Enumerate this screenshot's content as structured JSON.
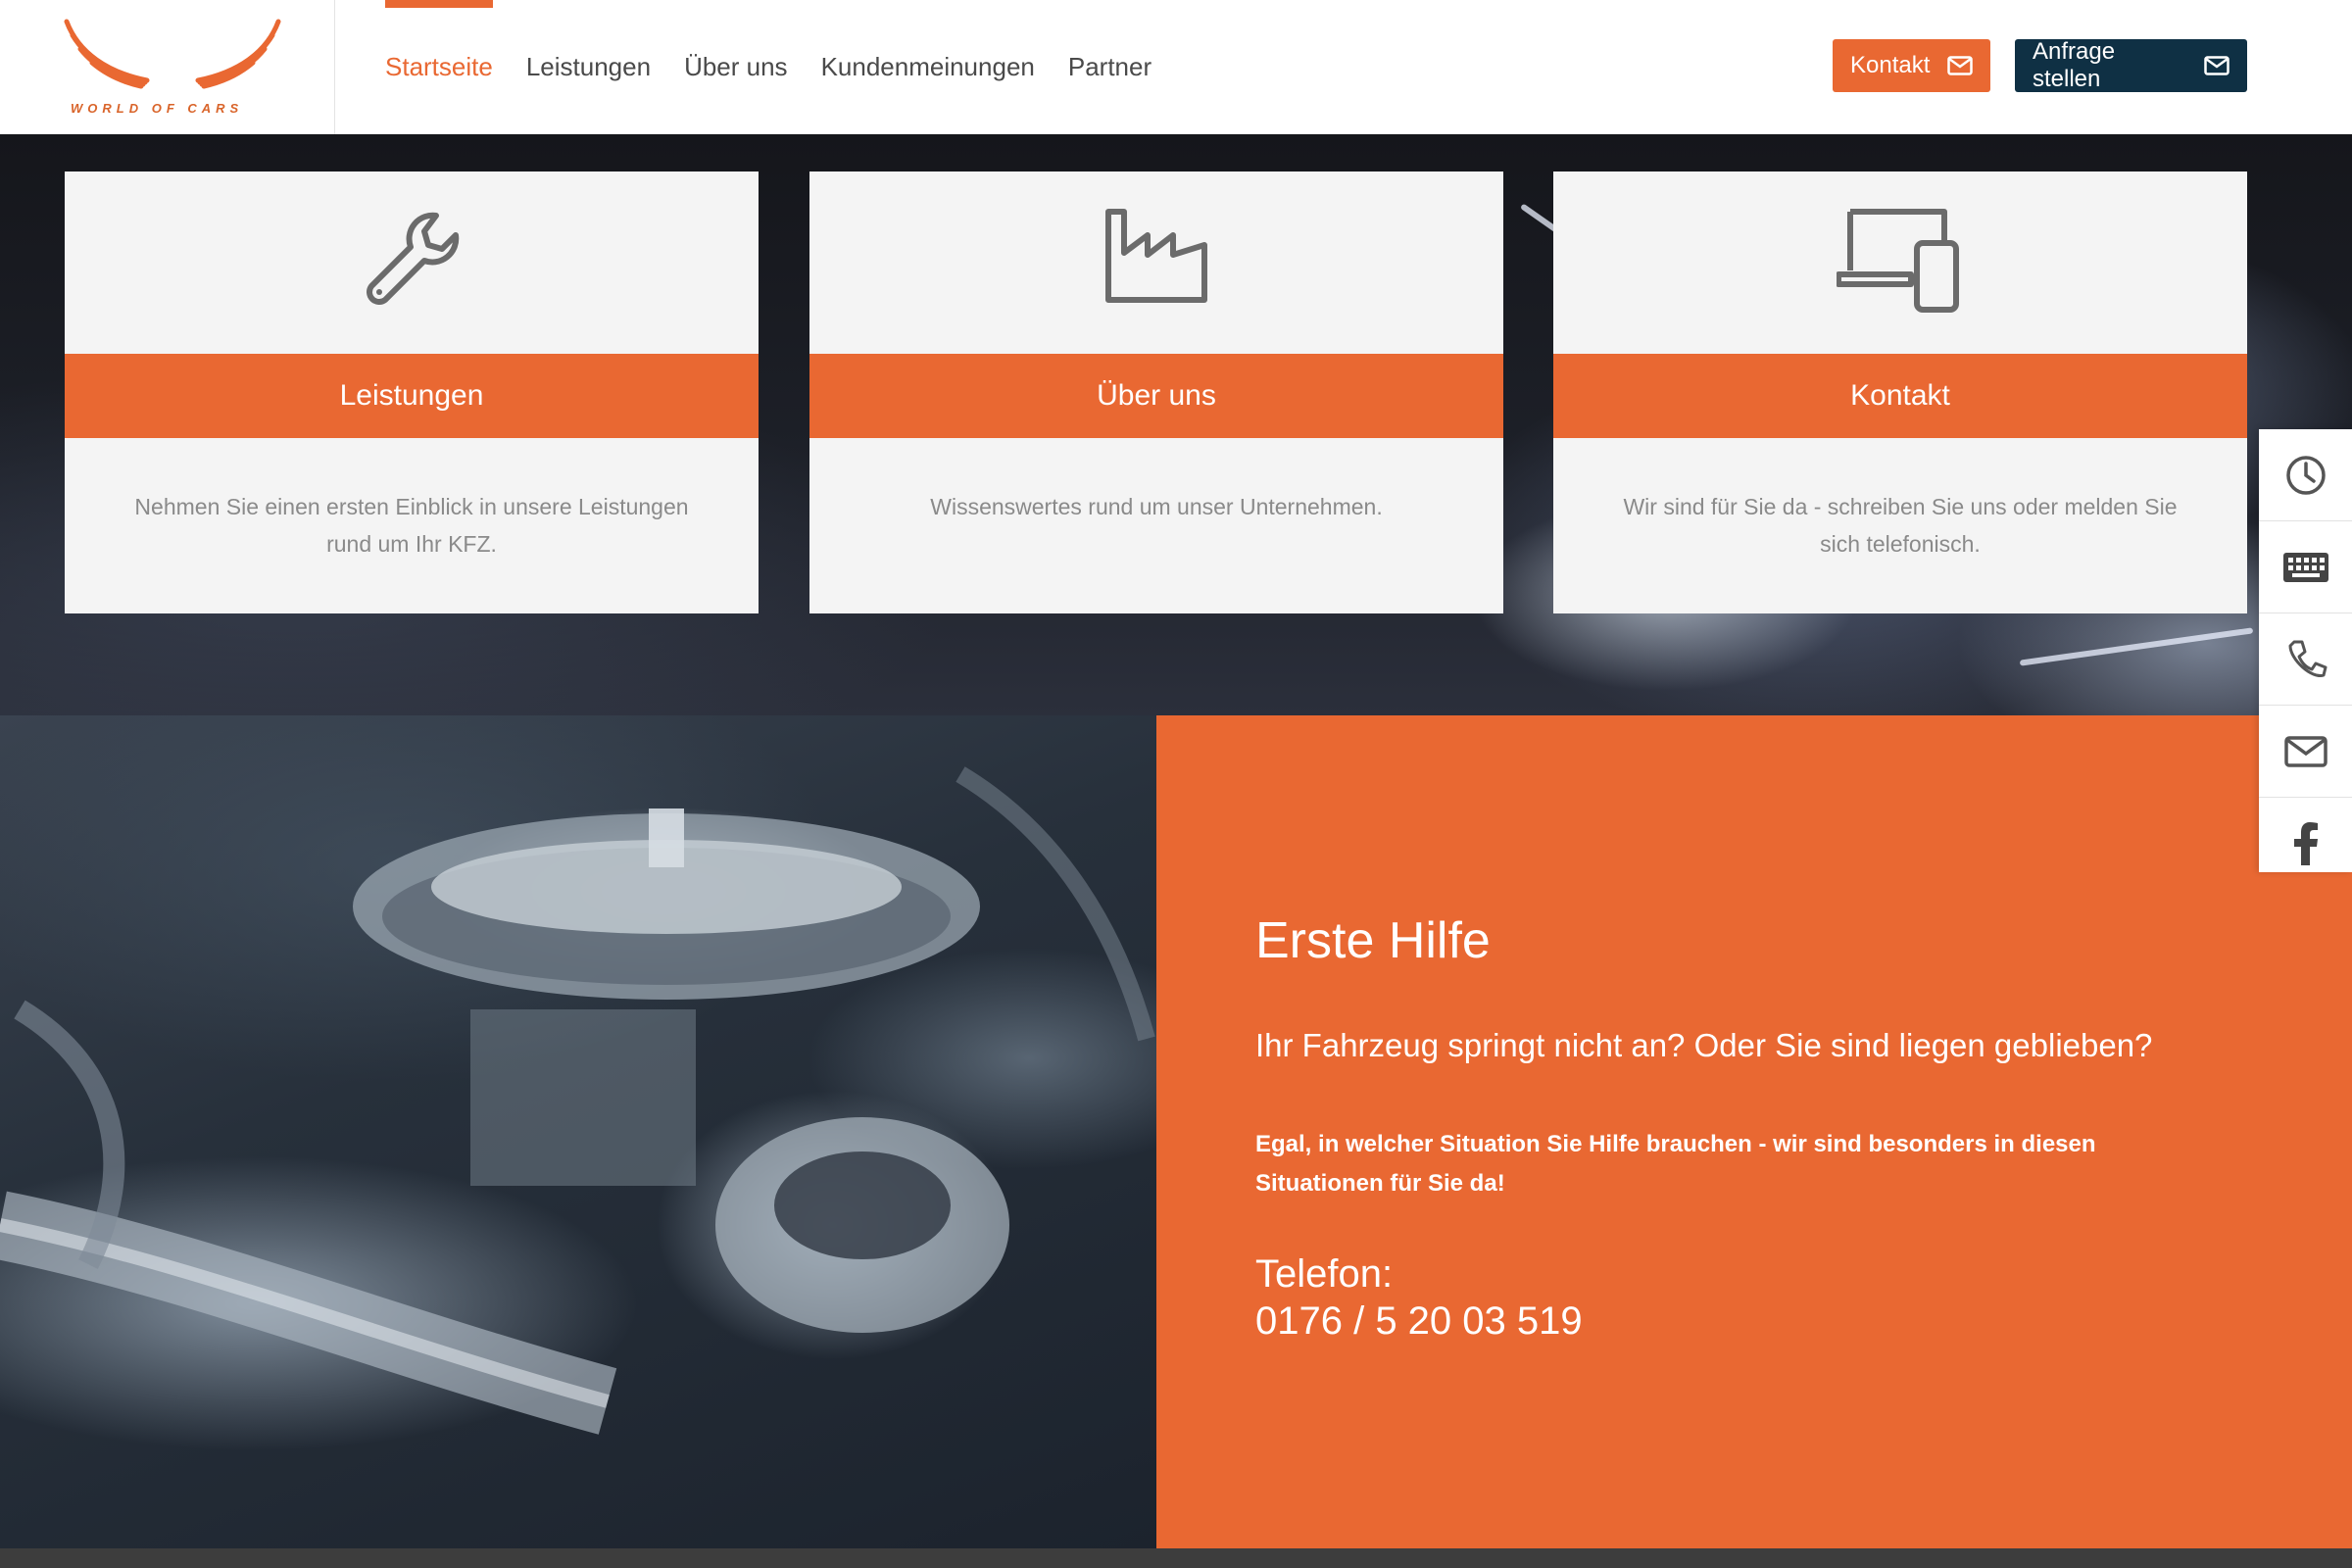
{
  "brand": {
    "logo_text": "WORLD OF CARS",
    "accent": "#e96832",
    "dark": "#0f3044"
  },
  "nav": {
    "items": [
      {
        "label": "Startseite",
        "active": true
      },
      {
        "label": "Leistungen"
      },
      {
        "label": "Über uns"
      },
      {
        "label": "Kundenmeinungen"
      },
      {
        "label": "Partner"
      }
    ]
  },
  "header": {
    "kontakt_label": "Kontakt",
    "anfrage_label": "Anfrage stellen"
  },
  "cards": [
    {
      "icon": "wrench-icon",
      "title": "Leistungen",
      "text": "Nehmen Sie einen ersten Einblick in unsere Leistungen rund um Ihr KFZ."
    },
    {
      "icon": "factory-icon",
      "title": "Über uns",
      "text": "Wissenswertes rund um unser Unternehmen."
    },
    {
      "icon": "devices-icon",
      "title": "Kontakt",
      "text": "Wir sind für Sie da - schreiben Sie uns oder melden Sie sich telefonisch."
    }
  ],
  "sidebar": {
    "icons": [
      "clock-icon",
      "keyboard-icon",
      "phone-icon",
      "mail-icon",
      "facebook-icon"
    ]
  },
  "help": {
    "title": "Erste Hilfe",
    "question": "Ihr Fahrzeug springt nicht an? Oder Sie sind liegen geblieben?",
    "paragraph": "Egal, in welcher Situation Sie Hilfe brauchen - wir sind besonders in diesen Situationen für Sie da!",
    "tel_label": "Telefon:",
    "tel_number": "0176 / 5 20 03 519"
  }
}
